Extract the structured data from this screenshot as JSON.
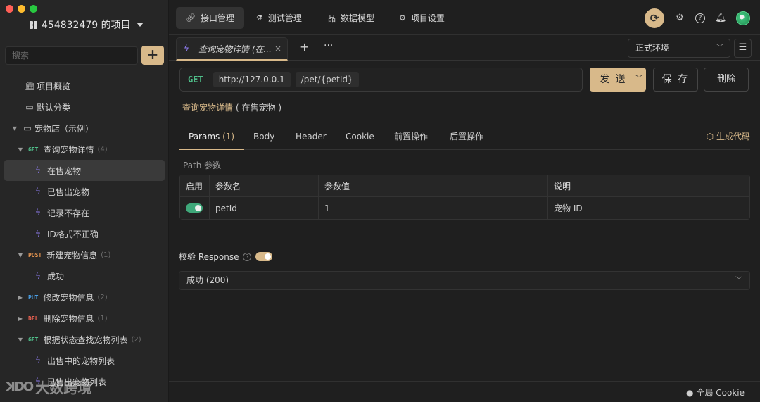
{
  "sidebar": {
    "project_title": "454832479 的项目",
    "search_placeholder": "搜索",
    "add_label": "+",
    "items": [
      {
        "label": "项目概览"
      },
      {
        "label": "默认分类"
      },
      {
        "label": "宠物店（示例）"
      },
      {
        "method": "GET",
        "label": "查询宠物详情",
        "count": "(4)"
      },
      {
        "label": "在售宠物"
      },
      {
        "label": "已售出宠物"
      },
      {
        "label": "记录不存在"
      },
      {
        "label": "ID格式不正确"
      },
      {
        "method": "POST",
        "label": "新建宠物信息",
        "count": "(1)"
      },
      {
        "label": "成功"
      },
      {
        "method": "PUT",
        "label": "修改宠物信息",
        "count": "(2)"
      },
      {
        "method": "DEL",
        "label": "删除宠物信息",
        "count": "(1)"
      },
      {
        "method": "GET",
        "label": "根据状态查找宠物列表",
        "count": "(2)"
      },
      {
        "label": "出售中的宠物列表"
      },
      {
        "label": "已售出宠物列表"
      }
    ],
    "watermark_text": "大数跨境",
    "watermark_logo": "ꓘDO"
  },
  "topbar": {
    "tabs": [
      {
        "label": "接口管理"
      },
      {
        "label": "测试管理"
      },
      {
        "label": "数据模型"
      },
      {
        "label": "项目设置"
      }
    ]
  },
  "request_tabs": {
    "active_tab": "查询宠物详情 (在...",
    "close": "×",
    "plus": "+",
    "more": "···",
    "environment": "正式环境"
  },
  "request": {
    "method": "GET",
    "base_url": "http://127.0.0.1",
    "path": "/pet/{petId}",
    "send_label": "发 送",
    "save_label": "保 存",
    "delete_label": "删除",
    "api_name": "查询宠物详情",
    "api_status": "( 在售宠物 )"
  },
  "params_tabs": {
    "tabs": [
      {
        "label": "Params",
        "count": "(1)"
      },
      {
        "label": "Body"
      },
      {
        "label": "Header"
      },
      {
        "label": "Cookie"
      },
      {
        "label": "前置操作"
      },
      {
        "label": "后置操作"
      }
    ],
    "generate_code": "生成代码"
  },
  "path_params": {
    "section_label": "Path 参数",
    "headers": [
      "启用",
      "参数名",
      "参数值",
      "说明"
    ],
    "rows": [
      {
        "enabled": true,
        "name": "petId",
        "value": "1",
        "desc": "宠物 ID"
      }
    ]
  },
  "validation": {
    "label": "校验 Response",
    "response_option": "成功 (200)"
  },
  "footer": {
    "cookie_label": "全局 Cookie"
  },
  "colors": {
    "accent": "#d8b98a",
    "get": "#4fbf8a",
    "post": "#e89650",
    "put": "#4a9fe6",
    "del": "#e86050"
  }
}
